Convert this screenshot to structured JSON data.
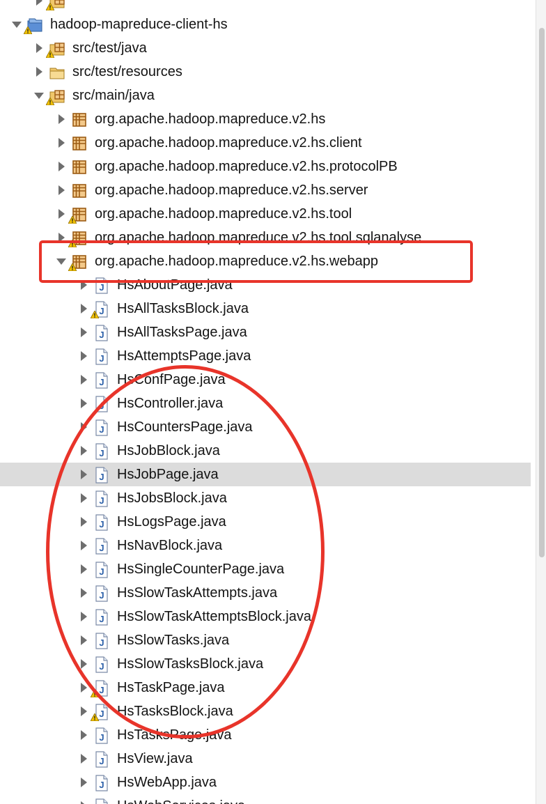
{
  "tree": {
    "items": [
      {
        "label": "",
        "depth": 1,
        "expanded": false,
        "icon": "package-folder-icon",
        "warning": true,
        "partial": true
      },
      {
        "label": "hadoop-mapreduce-client-hs",
        "depth": 0,
        "expanded": true,
        "icon": "project-icon",
        "warning": true
      },
      {
        "label": "src/test/java",
        "depth": 1,
        "expanded": false,
        "icon": "package-folder-icon",
        "warning": true
      },
      {
        "label": "src/test/resources",
        "depth": 1,
        "expanded": false,
        "icon": "folder-icon",
        "warning": false
      },
      {
        "label": "src/main/java",
        "depth": 1,
        "expanded": true,
        "icon": "package-folder-icon",
        "warning": true
      },
      {
        "label": "org.apache.hadoop.mapreduce.v2.hs",
        "depth": 2,
        "expanded": false,
        "icon": "package-icon",
        "warning": false
      },
      {
        "label": "org.apache.hadoop.mapreduce.v2.hs.client",
        "depth": 2,
        "expanded": false,
        "icon": "package-icon",
        "warning": false
      },
      {
        "label": "org.apache.hadoop.mapreduce.v2.hs.protocolPB",
        "depth": 2,
        "expanded": false,
        "icon": "package-icon",
        "warning": false
      },
      {
        "label": "org.apache.hadoop.mapreduce.v2.hs.server",
        "depth": 2,
        "expanded": false,
        "icon": "package-icon",
        "warning": false
      },
      {
        "label": "org.apache.hadoop.mapreduce.v2.hs.tool",
        "depth": 2,
        "expanded": false,
        "icon": "package-icon",
        "warning": true
      },
      {
        "label": "org.apache.hadoop.mapreduce.v2.hs.tool.sqlanalyse",
        "depth": 2,
        "expanded": false,
        "icon": "package-icon",
        "warning": true
      },
      {
        "label": "org.apache.hadoop.mapreduce.v2.hs.webapp",
        "depth": 2,
        "expanded": true,
        "icon": "package-icon",
        "warning": true
      },
      {
        "label": "HsAboutPage.java",
        "depth": 3,
        "expanded": false,
        "icon": "java-file-icon",
        "warning": false
      },
      {
        "label": "HsAllTasksBlock.java",
        "depth": 3,
        "expanded": false,
        "icon": "java-file-icon",
        "warning": true
      },
      {
        "label": "HsAllTasksPage.java",
        "depth": 3,
        "expanded": false,
        "icon": "java-file-icon",
        "warning": false
      },
      {
        "label": "HsAttemptsPage.java",
        "depth": 3,
        "expanded": false,
        "icon": "java-file-icon",
        "warning": false
      },
      {
        "label": "HsConfPage.java",
        "depth": 3,
        "expanded": false,
        "icon": "java-file-icon",
        "warning": false
      },
      {
        "label": "HsController.java",
        "depth": 3,
        "expanded": false,
        "icon": "java-file-icon",
        "warning": false
      },
      {
        "label": "HsCountersPage.java",
        "depth": 3,
        "expanded": false,
        "icon": "java-file-icon",
        "warning": false
      },
      {
        "label": "HsJobBlock.java",
        "depth": 3,
        "expanded": false,
        "icon": "java-file-icon",
        "warning": false
      },
      {
        "label": "HsJobPage.java",
        "depth": 3,
        "expanded": false,
        "icon": "java-file-icon",
        "warning": false,
        "selected": true
      },
      {
        "label": "HsJobsBlock.java",
        "depth": 3,
        "expanded": false,
        "icon": "java-file-icon",
        "warning": false
      },
      {
        "label": "HsLogsPage.java",
        "depth": 3,
        "expanded": false,
        "icon": "java-file-icon",
        "warning": false
      },
      {
        "label": "HsNavBlock.java",
        "depth": 3,
        "expanded": false,
        "icon": "java-file-icon",
        "warning": false
      },
      {
        "label": "HsSingleCounterPage.java",
        "depth": 3,
        "expanded": false,
        "icon": "java-file-icon",
        "warning": false
      },
      {
        "label": "HsSlowTaskAttempts.java",
        "depth": 3,
        "expanded": false,
        "icon": "java-file-icon",
        "warning": false
      },
      {
        "label": "HsSlowTaskAttemptsBlock.java",
        "depth": 3,
        "expanded": false,
        "icon": "java-file-icon",
        "warning": false
      },
      {
        "label": "HsSlowTasks.java",
        "depth": 3,
        "expanded": false,
        "icon": "java-file-icon",
        "warning": false
      },
      {
        "label": "HsSlowTasksBlock.java",
        "depth": 3,
        "expanded": false,
        "icon": "java-file-icon",
        "warning": false
      },
      {
        "label": "HsTaskPage.java",
        "depth": 3,
        "expanded": false,
        "icon": "java-file-icon",
        "warning": true
      },
      {
        "label": "HsTasksBlock.java",
        "depth": 3,
        "expanded": false,
        "icon": "java-file-icon",
        "warning": true
      },
      {
        "label": "HsTasksPage.java",
        "depth": 3,
        "expanded": false,
        "icon": "java-file-icon",
        "warning": false
      },
      {
        "label": "HsView.java",
        "depth": 3,
        "expanded": false,
        "icon": "java-file-icon",
        "warning": false
      },
      {
        "label": "HsWebApp.java",
        "depth": 3,
        "expanded": false,
        "icon": "java-file-icon",
        "warning": false
      },
      {
        "label": "HsWebServices.java",
        "depth": 3,
        "expanded": false,
        "icon": "java-file-icon",
        "warning": false
      }
    ]
  },
  "annotations": {
    "color": "#e8342a",
    "shapes": [
      "highlight-rectangle",
      "highlight-oval"
    ]
  },
  "colors": {
    "selection": "#dcdcdc",
    "text": "#141414",
    "warning": "#f2c200",
    "java_icon": "#2b5fa8"
  }
}
